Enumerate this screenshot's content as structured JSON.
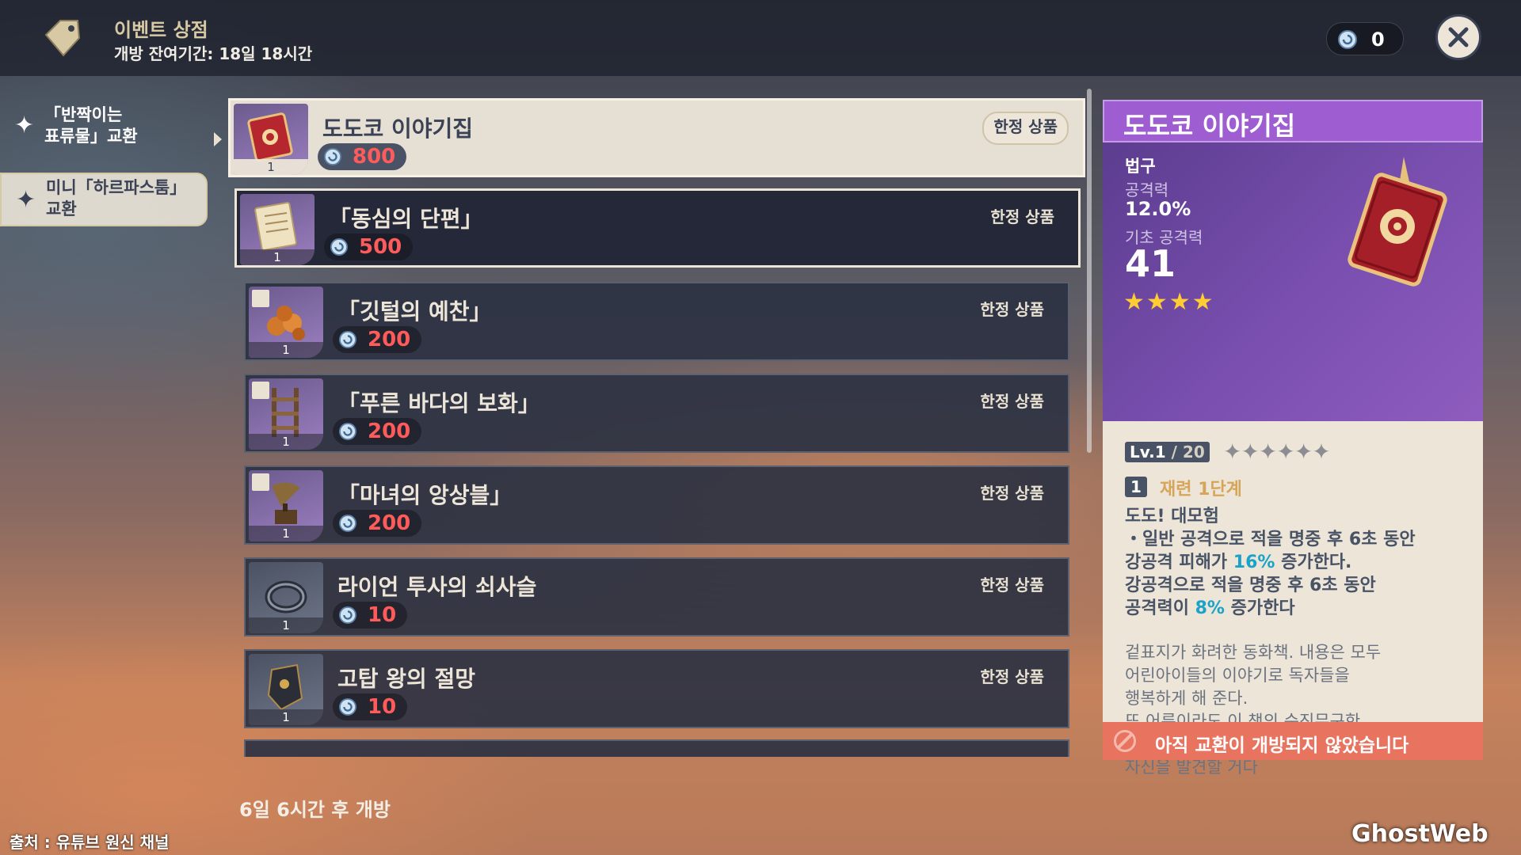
{
  "header": {
    "title": "이벤트 상점",
    "remaining": "개방 잔여기간: 18일 18시간",
    "currency_amount": "0"
  },
  "nav": {
    "items": [
      {
        "label": "「반짝이는\n표류물」교환"
      },
      {
        "label": "미니「하르파스툼」\n교환"
      }
    ]
  },
  "items": [
    {
      "name": "도도코 이야기집",
      "price": "800",
      "qty": "1",
      "tag": "한정 상품"
    },
    {
      "name": "「동심의 단편」",
      "price": "500",
      "qty": "1",
      "tag": "한정 상품"
    },
    {
      "name": "「깃털의 예찬」",
      "price": "200",
      "qty": "1",
      "tag": "한정 상품"
    },
    {
      "name": "「푸른 바다의 보화」",
      "price": "200",
      "qty": "1",
      "tag": "한정 상품"
    },
    {
      "name": "「마녀의 앙상블」",
      "price": "200",
      "qty": "1",
      "tag": "한정 상품"
    },
    {
      "name": "라이언 투사의 쇠사슬",
      "price": "10",
      "qty": "1",
      "tag": "한정 상품"
    },
    {
      "name": "고탑 왕의 절망",
      "price": "10",
      "qty": "1",
      "tag": "한정 상품"
    }
  ],
  "next_open": "6일 6시간 후 개방",
  "detail": {
    "title": "도도코 이야기집",
    "category": "법구",
    "sub_label": "공격력",
    "sub_value": "12.0%",
    "base_label": "기초 공격력",
    "base_value": "41",
    "rarity": 4,
    "stars_text": "★★★★",
    "level": "Lv.1",
    "level_max": "/ 20",
    "empty_stars": "✦✦✦✦✦✦",
    "refine_num": "1",
    "refine_text": "재련 1단계",
    "passive_title": "도도! 대모험",
    "passive_l1": "・일반 공격으로 적을 명중 후 6초 동안",
    "passive_l2a": "강공격 피해가 ",
    "passive_pct1": "16%",
    "passive_l2b": " 증가한다.",
    "passive_l3": "강공격으로 적을 명중 후 6초 동안",
    "passive_l4a": "공격력이 ",
    "passive_pct2": "8%",
    "passive_l4b": " 증가한다",
    "flavor": "겉표지가 화려한 동화책. 내용은 모두\n어린아이들의 이야기로 독자들을\n행복하게 해 준다.\n또 어른이라도 이 책의 순진무구한\n모험담을 읽으면 어느새 집중하고 있는\n자신을 발견할 거다",
    "footer": "아직 교환이 개방되지 않았습니다"
  },
  "source": "출처 : 유튜브 원신 채널",
  "watermark": "GhostWeb",
  "colors": {
    "price_red": "#ff5b5b",
    "purple_rarity": "#9e5ed1",
    "footer_red": "#e8735f",
    "highlight": "#1aa3c9"
  }
}
